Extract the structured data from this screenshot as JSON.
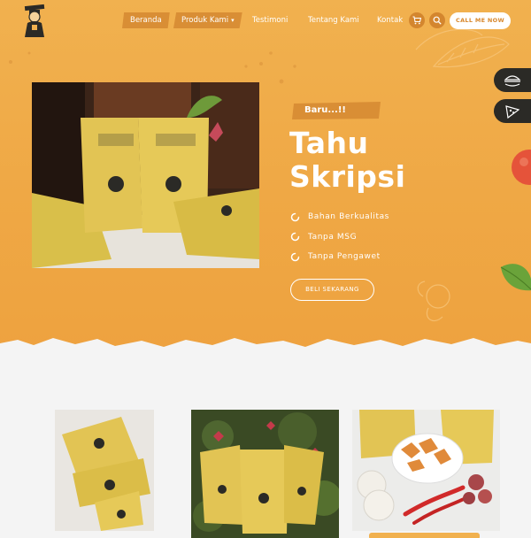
{
  "nav": {
    "items": [
      {
        "label": "Beranda"
      },
      {
        "label": "Produk Kami",
        "chevron": "▾"
      },
      {
        "label": "Testimoni"
      },
      {
        "label": "Tentang Kami"
      },
      {
        "label": "Kontak"
      }
    ],
    "cart_icon": "cart-icon",
    "search_icon": "search-icon",
    "cta_label": "CALL ME NOW"
  },
  "hero": {
    "badge": "Baru...!!",
    "title_line1": "Tahu",
    "title_line2": "Skripsi",
    "features": [
      "Bahan Berkualitas",
      "Tanpa MSG",
      "Tanpa Pengawet"
    ],
    "button_label": "BELI SEKARANG"
  },
  "side_tabs": [
    "burger-icon",
    "pizza-icon"
  ],
  "colors": {
    "primary": "#efa845",
    "accent": "#d98e35",
    "dark": "#2b2a26",
    "white": "#ffffff"
  }
}
